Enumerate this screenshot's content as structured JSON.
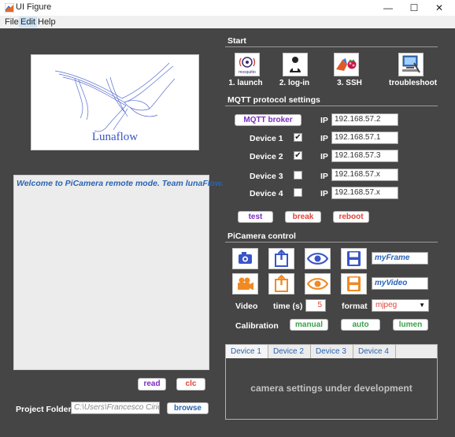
{
  "window": {
    "title": "UI Figure",
    "controls": {
      "minimize": "—",
      "maximize": "☐",
      "close": "✕"
    }
  },
  "menu": [
    "File",
    "Edit",
    "Help"
  ],
  "logo": {
    "text": "Lunaflow"
  },
  "console": {
    "message": "Welcome to PiCamera remote mode. Team lunaFlow."
  },
  "left_buttons": {
    "read": "read",
    "clc": "clc"
  },
  "project": {
    "label": "Project Folder",
    "path": "C:\\Users\\Francesco Cirielli",
    "browse": "browse"
  },
  "start": {
    "title": "Start",
    "items": [
      {
        "label": "1. launch",
        "icon": "mosquitto-icon"
      },
      {
        "label": "2. log-in",
        "icon": "login-icon"
      },
      {
        "label": "3. SSH",
        "icon": "ssh-icon"
      },
      {
        "label": "troubleshoot",
        "icon": "troubleshoot-icon"
      }
    ]
  },
  "mqtt": {
    "title": "MQTT protocol settings",
    "broker_button": "MQTT broker",
    "ip_label": "IP",
    "broker_ip": "192.168.57.2",
    "devices": [
      {
        "label": "Device 1",
        "checked": true,
        "ip": "192.168.57.1"
      },
      {
        "label": "Device 2",
        "checked": true,
        "ip": "192.168.57.3"
      },
      {
        "label": "Device 3",
        "checked": false,
        "ip": "192.168.57.x"
      },
      {
        "label": "Device 4",
        "checked": false,
        "ip": "192.168.57.x"
      }
    ],
    "buttons": {
      "test": "test",
      "break": "break",
      "reboot": "reboot"
    }
  },
  "picamera": {
    "title": "PiCamera control",
    "frame_name": "myFrame",
    "video_name": "myVideo",
    "video_label": "Video",
    "time_label": "time (s)",
    "time_value": "5",
    "format_label": "format",
    "format_value": "mjpeg",
    "calibration_label": "Calibration",
    "calibration_buttons": {
      "manual": "manual",
      "auto": "auto",
      "lumen": "lumen"
    },
    "colors": {
      "blue": "#3a55c8",
      "orange": "#f08a24"
    }
  },
  "tabs": {
    "items": [
      "Device 1",
      "Device 2",
      "Device 3",
      "Device 4"
    ],
    "active": "Device 1",
    "message": "camera settings under development"
  }
}
